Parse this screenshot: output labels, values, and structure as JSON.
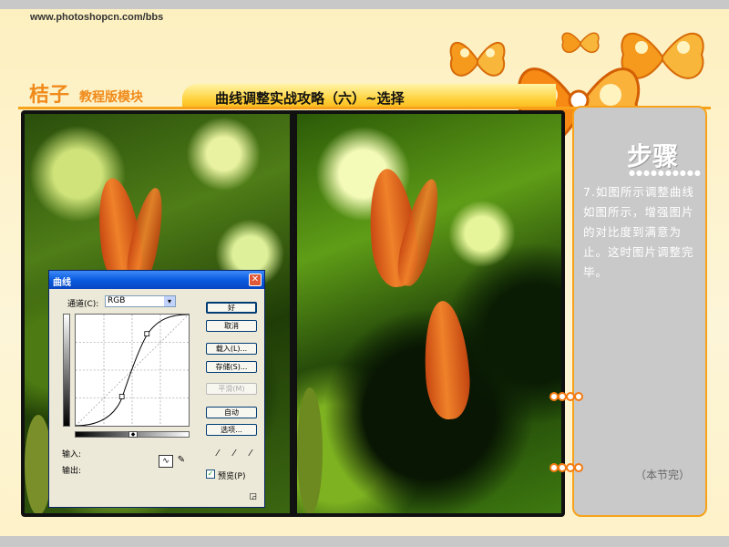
{
  "header": {
    "site_url": "www.photoshopcn.com/bbs",
    "brand": "桔子",
    "brand_sub": "教程版模块",
    "title": "曲线调整实战攻略（六）~选择"
  },
  "curves_dialog": {
    "title": "曲线",
    "close_glyph": "✕",
    "channel_label": "通道(C):",
    "channel_value": "RGB",
    "channel_arrow": "▾",
    "input_label": "输入:",
    "output_label": "输出:",
    "buttons": {
      "ok": "好",
      "cancel": "取消",
      "load": "载入(L)...",
      "save": "存储(S)...",
      "smooth": "平滑(M)",
      "auto": "自动",
      "options": "选项..."
    },
    "preview_label": "预览(P)",
    "preview_checked": true,
    "check_glyph": "✓",
    "eyedropper_icons": [
      "black-eyedropper-icon",
      "gray-eyedropper-icon",
      "white-eyedropper-icon"
    ],
    "eyedropper_glyph": "⁄",
    "tool_curve_glyph": "∿",
    "tool_pencil_glyph": "✎",
    "slider_handle_glyph": "◆",
    "resize_glyph": "◲"
  },
  "step_panel": {
    "heading": "步骤",
    "dots": "●●●●●●●●●●",
    "body": "7.如图所示调整曲线如图所示，增强图片的对比度到满意为止。这时图片调整完毕。",
    "end_note": "（本节完）"
  },
  "colors": {
    "accent_orange": "#f7a21a",
    "title_bar_yellow": "#ffd23c",
    "panel_gray": "#c9c9c9",
    "xp_blue": "#0a5be0"
  }
}
